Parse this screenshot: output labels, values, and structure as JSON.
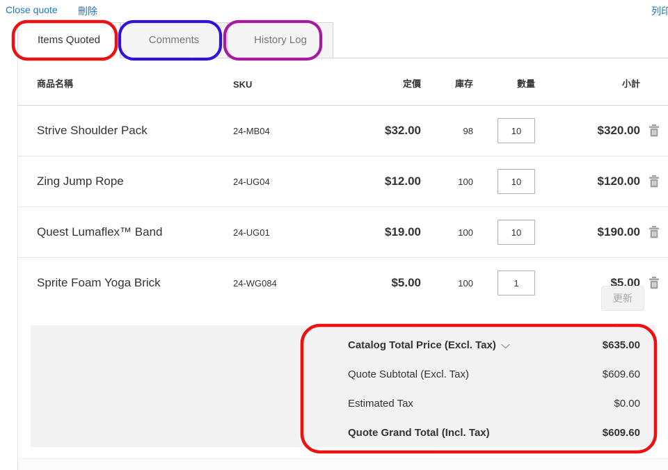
{
  "toplinks": {
    "close_quote": "Close quote",
    "delete": "刪除",
    "print": "列印"
  },
  "tabs": [
    {
      "label": "Items Quoted",
      "active": true
    },
    {
      "label": "Comments",
      "active": false
    },
    {
      "label": "History Log",
      "active": false
    }
  ],
  "table": {
    "headers": {
      "name": "商品名稱",
      "sku": "SKU",
      "price": "定價",
      "stock": "庫存",
      "qty": "數量",
      "subtotal": "小計"
    },
    "rows": [
      {
        "name": "Strive Shoulder Pack",
        "sku": "24-MB04",
        "price": "$32.00",
        "stock": "98",
        "qty": "10",
        "subtotal": "$320.00",
        "delete_icon": "trash-icon"
      },
      {
        "name": "Zing Jump Rope",
        "sku": "24-UG04",
        "price": "$12.00",
        "stock": "100",
        "qty": "10",
        "subtotal": "$120.00",
        "delete_icon": "trash-icon"
      },
      {
        "name": "Quest Lumaflex™ Band",
        "sku": "24-UG01",
        "price": "$19.00",
        "stock": "100",
        "qty": "10",
        "subtotal": "$190.00",
        "delete_icon": "trash-icon"
      },
      {
        "name": "Sprite Foam Yoga Brick",
        "sku": "24-WG084",
        "price": "$5.00",
        "stock": "100",
        "qty": "1",
        "subtotal": "$5.00",
        "delete_icon": "trash-icon"
      }
    ]
  },
  "update_button": {
    "label": "更新",
    "disabled": true
  },
  "totals": [
    {
      "label": "Catalog Total Price (Excl. Tax)",
      "value": "$635.00",
      "bold": true,
      "chevron": "chevron-down-icon"
    },
    {
      "label": "Quote Subtotal (Excl. Tax)",
      "value": "$609.60",
      "bold": false
    },
    {
      "label": "Estimated Tax",
      "value": "$0.00",
      "bold": false
    },
    {
      "label": "Quote Grand Total (Incl. Tax)",
      "value": "$609.60",
      "bold": true
    }
  ],
  "colors": {
    "link": "#1979c3",
    "text": "#333333",
    "tab_inactive_bg": "#f5f5f5",
    "tab_inactive_text": "#777777",
    "band_bg": "#f2f2f2",
    "border": "#d6d6d6",
    "annot_red": "#ee1111",
    "annot_blue": "#3311dd",
    "annot_purple": "#a9199f"
  }
}
